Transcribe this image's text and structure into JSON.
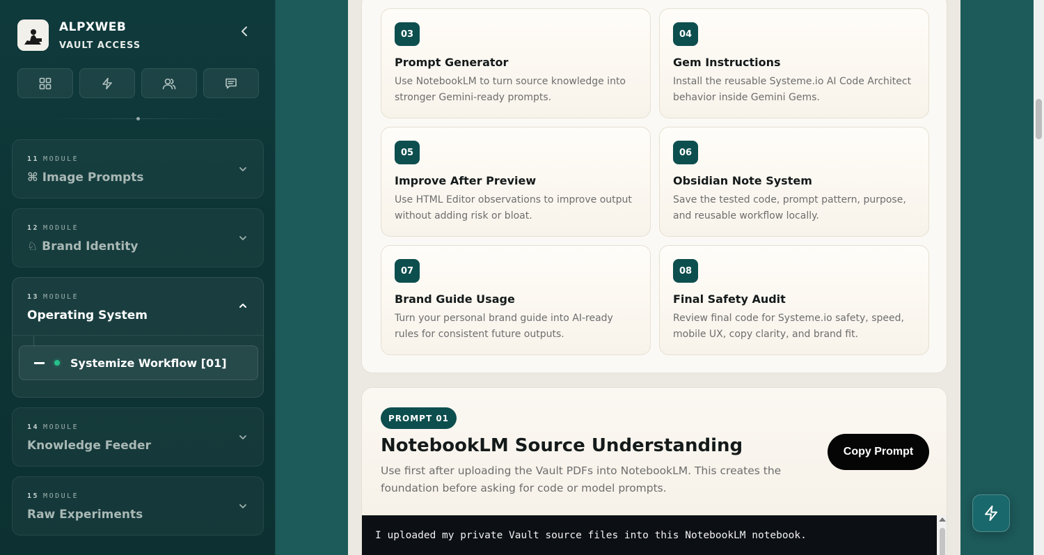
{
  "sidebar": {
    "brand_name": "ALPXWEB",
    "brand_sub": "VAULT ACCESS",
    "quick_actions": [
      "grid-icon",
      "lightning-icon",
      "users-icon",
      "message-icon"
    ],
    "modules": [
      {
        "num": "11",
        "label": "MODULE",
        "title": "⌘ Image Prompts",
        "state": "collapsed"
      },
      {
        "num": "12",
        "label": "MODULE",
        "title": "♘ Brand Identity",
        "state": "collapsed"
      },
      {
        "num": "13",
        "label": "MODULE",
        "title": "Operating System",
        "state": "open",
        "sub_item": "Systemize Workflow [01]"
      },
      {
        "num": "14",
        "label": "MODULE",
        "title": "Knowledge Feeder",
        "state": "collapsed"
      },
      {
        "num": "15",
        "label": "MODULE",
        "title": "Raw Experiments",
        "state": "collapsed"
      }
    ]
  },
  "steps": [
    {
      "num": "03",
      "title": "Prompt Generator",
      "desc": "Use NotebookLM to turn source knowledge into stronger Gemini-ready prompts."
    },
    {
      "num": "04",
      "title": "Gem Instructions",
      "desc": "Install the reusable Systeme.io AI Code Architect behavior inside Gemini Gems."
    },
    {
      "num": "05",
      "title": "Improve After Preview",
      "desc": "Use HTML Editor observations to improve output without adding risk or bloat."
    },
    {
      "num": "06",
      "title": "Obsidian Note System",
      "desc": "Save the tested code, prompt pattern, purpose, and reusable workflow locally."
    },
    {
      "num": "07",
      "title": "Brand Guide Usage",
      "desc": "Turn your personal brand guide into AI-ready rules for consistent future outputs."
    },
    {
      "num": "08",
      "title": "Final Safety Audit",
      "desc": "Review final code for Systeme.io safety, speed, mobile UX, copy clarity, and brand fit."
    }
  ],
  "prompt": {
    "badge": "PROMPT 01",
    "title": "NotebookLM Source Understanding",
    "desc": "Use first after uploading the Vault PDFs into NotebookLM. This creates the foundation before asking for code or model prompts.",
    "copy_label": "Copy Prompt",
    "code": "I uploaded my private Vault source files into this NotebookLM notebook."
  },
  "colors": {
    "accent": "#0d4e4e",
    "sidebar_bg": "#0f3a3c",
    "active_dot": "#27c08a"
  }
}
